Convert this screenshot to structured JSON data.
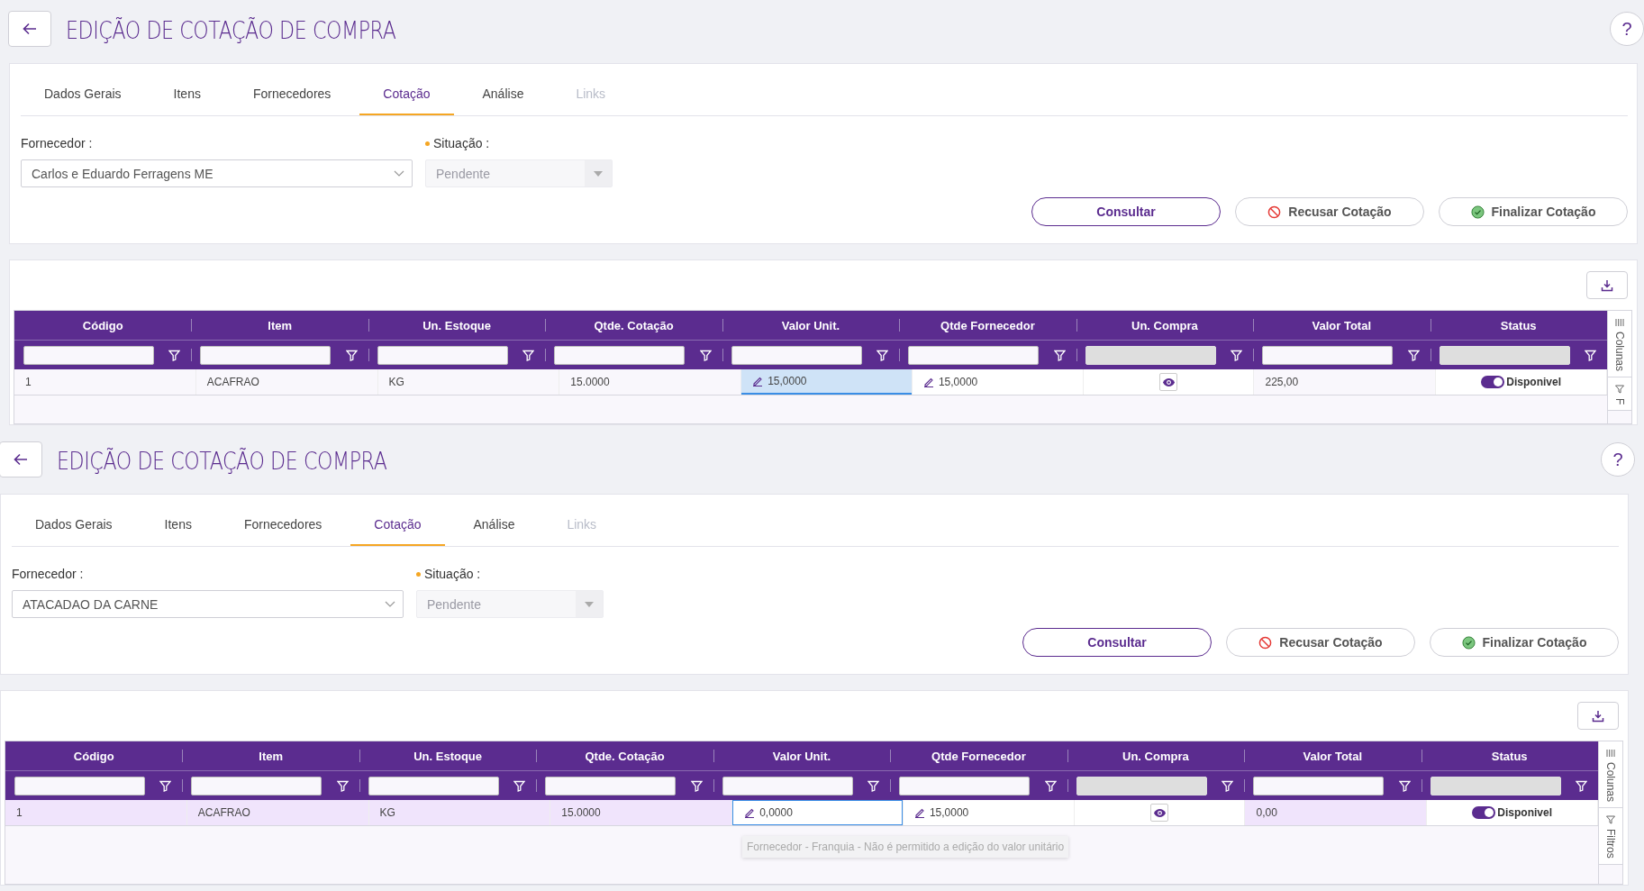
{
  "screens": [
    {
      "title": "EDIÇÃO DE COTAÇÃO DE COMPRA",
      "help": "?",
      "tabs": [
        {
          "label": "Dados Gerais",
          "selected": false,
          "disabled": false
        },
        {
          "label": "Itens",
          "selected": false,
          "disabled": false
        },
        {
          "label": "Fornecedores",
          "selected": false,
          "disabled": false
        },
        {
          "label": "Cotação",
          "selected": true,
          "disabled": false
        },
        {
          "label": "Análise",
          "selected": false,
          "disabled": false
        },
        {
          "label": "Links",
          "selected": false,
          "disabled": true
        }
      ],
      "fields": [
        {
          "label": "Fornecedor :",
          "value": "Carlos e Eduardo Ferragens ME",
          "disabled": false
        },
        {
          "label": "Situação :",
          "required": true,
          "value": "Pendente",
          "disabled": true
        }
      ],
      "buttons": [
        {
          "label": "Consultar",
          "kind": "primary"
        },
        {
          "label": "Recusar Cotação",
          "kind": "reject"
        },
        {
          "label": "Finalizar Cotação",
          "kind": "finalize"
        }
      ],
      "table": {
        "columns": [
          {
            "label": "Código",
            "filter_disabled": false
          },
          {
            "label": "Item",
            "filter_disabled": false
          },
          {
            "label": "Un. Estoque",
            "filter_disabled": false
          },
          {
            "label": "Qtde. Cotação",
            "filter_disabled": false
          },
          {
            "label": "Valor Unit.",
            "filter_disabled": false
          },
          {
            "label": "Qtde Fornecedor",
            "filter_disabled": false
          },
          {
            "label": "Un. Compra",
            "filter_disabled": true
          },
          {
            "label": "Valor Total",
            "filter_disabled": false
          },
          {
            "label": "Status",
            "filter_disabled": true
          }
        ],
        "rows": [
          {
            "selected": false,
            "cells": [
              {
                "kind": "text",
                "value": "1"
              },
              {
                "kind": "text",
                "value": "ACAFRAO"
              },
              {
                "kind": "text",
                "value": "KG"
              },
              {
                "kind": "text",
                "value": "15.0000"
              },
              {
                "kind": "edit",
                "value": "15,0000",
                "focused": true
              },
              {
                "kind": "edit",
                "value": "15,0000",
                "focused": false
              },
              {
                "kind": "view"
              },
              {
                "kind": "text",
                "value": "225,00"
              },
              {
                "kind": "toggle",
                "value": "Disponivel",
                "on": true
              }
            ]
          }
        ]
      },
      "side_tabs": [
        "Colunas",
        "F"
      ]
    },
    {
      "title": "EDIÇÃO DE COTAÇÃO DE COMPRA",
      "help": "?",
      "tabs": [
        {
          "label": "Dados Gerais",
          "selected": false,
          "disabled": false
        },
        {
          "label": "Itens",
          "selected": false,
          "disabled": false
        },
        {
          "label": "Fornecedores",
          "selected": false,
          "disabled": false
        },
        {
          "label": "Cotação",
          "selected": true,
          "disabled": false
        },
        {
          "label": "Análise",
          "selected": false,
          "disabled": false
        },
        {
          "label": "Links",
          "selected": false,
          "disabled": true
        }
      ],
      "fields": [
        {
          "label": "Fornecedor :",
          "value": "ATACADAO DA CARNE",
          "disabled": false
        },
        {
          "label": "Situação :",
          "required": true,
          "value": "Pendente",
          "disabled": true
        }
      ],
      "buttons": [
        {
          "label": "Consultar",
          "kind": "primary"
        },
        {
          "label": "Recusar Cotação",
          "kind": "reject"
        },
        {
          "label": "Finalizar Cotação",
          "kind": "finalize"
        }
      ],
      "table": {
        "columns": [
          {
            "label": "Código",
            "filter_disabled": false
          },
          {
            "label": "Item",
            "filter_disabled": false
          },
          {
            "label": "Un. Estoque",
            "filter_disabled": false
          },
          {
            "label": "Qtde. Cotação",
            "filter_disabled": false
          },
          {
            "label": "Valor Unit.",
            "filter_disabled": false
          },
          {
            "label": "Qtde Fornecedor",
            "filter_disabled": false
          },
          {
            "label": "Un. Compra",
            "filter_disabled": true
          },
          {
            "label": "Valor Total",
            "filter_disabled": false
          },
          {
            "label": "Status",
            "filter_disabled": true
          }
        ],
        "rows": [
          {
            "selected": true,
            "cells": [
              {
                "kind": "text",
                "value": "1"
              },
              {
                "kind": "text",
                "value": "ACAFRAO"
              },
              {
                "kind": "text",
                "value": "KG"
              },
              {
                "kind": "text",
                "value": "15.0000"
              },
              {
                "kind": "edit",
                "value": "0,0000",
                "focused": true
              },
              {
                "kind": "edit",
                "value": "15,0000",
                "focused": false
              },
              {
                "kind": "view"
              },
              {
                "kind": "text",
                "value": "0,00"
              },
              {
                "kind": "toggle",
                "value": "Disponivel",
                "on": true
              }
            ]
          }
        ]
      },
      "tooltip": "Fornecedor - Franquia - Não é permitido a edição do valor unitário",
      "side_tabs": [
        "Colunas",
        "Filtros"
      ]
    }
  ]
}
